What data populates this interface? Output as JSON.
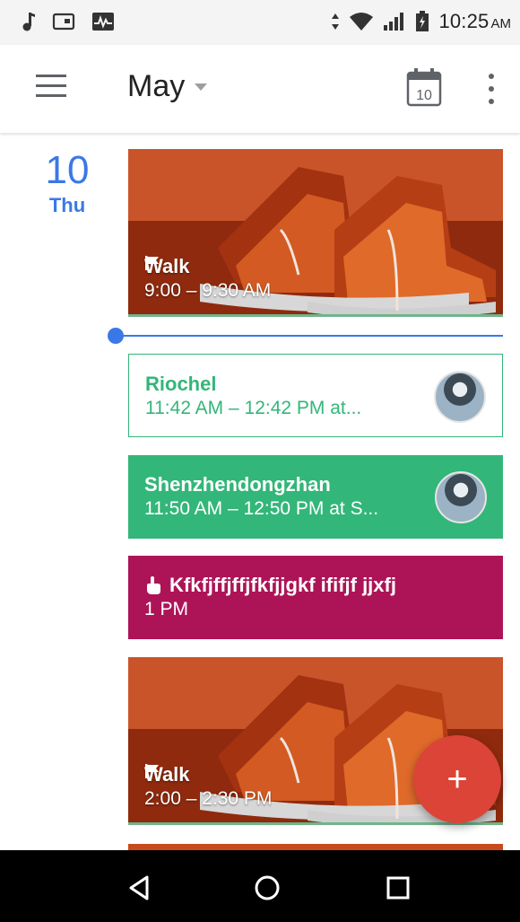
{
  "status_bar": {
    "time": "10:25",
    "ampm": "AM",
    "icons": [
      "music-note-icon",
      "tablet-icon",
      "activity-monitor-icon",
      "data-arrows-icon",
      "wifi-icon",
      "signal-icon",
      "battery-icon"
    ]
  },
  "app_bar": {
    "month": "May",
    "today_date": "10",
    "icons": [
      "hamburger-menu-icon",
      "dropdown-arrow-icon",
      "calendar-today-icon",
      "more-vert-icon"
    ]
  },
  "day": {
    "number": "10",
    "weekday": "Thu"
  },
  "events": [
    {
      "type": "goal",
      "title": "Walk",
      "time": "9:00 – 9:30 AM",
      "icon": "flag-icon"
    },
    {
      "type": "event",
      "title": "Riochel",
      "time": "11:42 AM – 12:42 PM at...",
      "color": "#33b679",
      "style": "outlined",
      "icon": "avatar"
    },
    {
      "type": "event",
      "title": "Shenzhendongzhan",
      "time": "11:50 AM – 12:50 PM at S...",
      "color": "#33b679",
      "style": "filled",
      "icon": "avatar"
    },
    {
      "type": "reminder",
      "title": "Kfkfjffjffjfkfjjgkf ififjf jjxfj",
      "time": "1 PM",
      "color": "#ad1457",
      "icon": "reminder-hand-icon"
    },
    {
      "type": "goal",
      "title": "Walk",
      "time": "2:00 – 2:30 PM",
      "icon": "flag-icon"
    }
  ],
  "fab": {
    "label": "+",
    "color": "#db4437"
  },
  "nav_bar": {
    "icons": [
      "back-icon",
      "home-icon",
      "recents-icon"
    ]
  },
  "colors": {
    "accent": "#3b78e7",
    "green": "#33b679",
    "magenta": "#ad1457"
  }
}
